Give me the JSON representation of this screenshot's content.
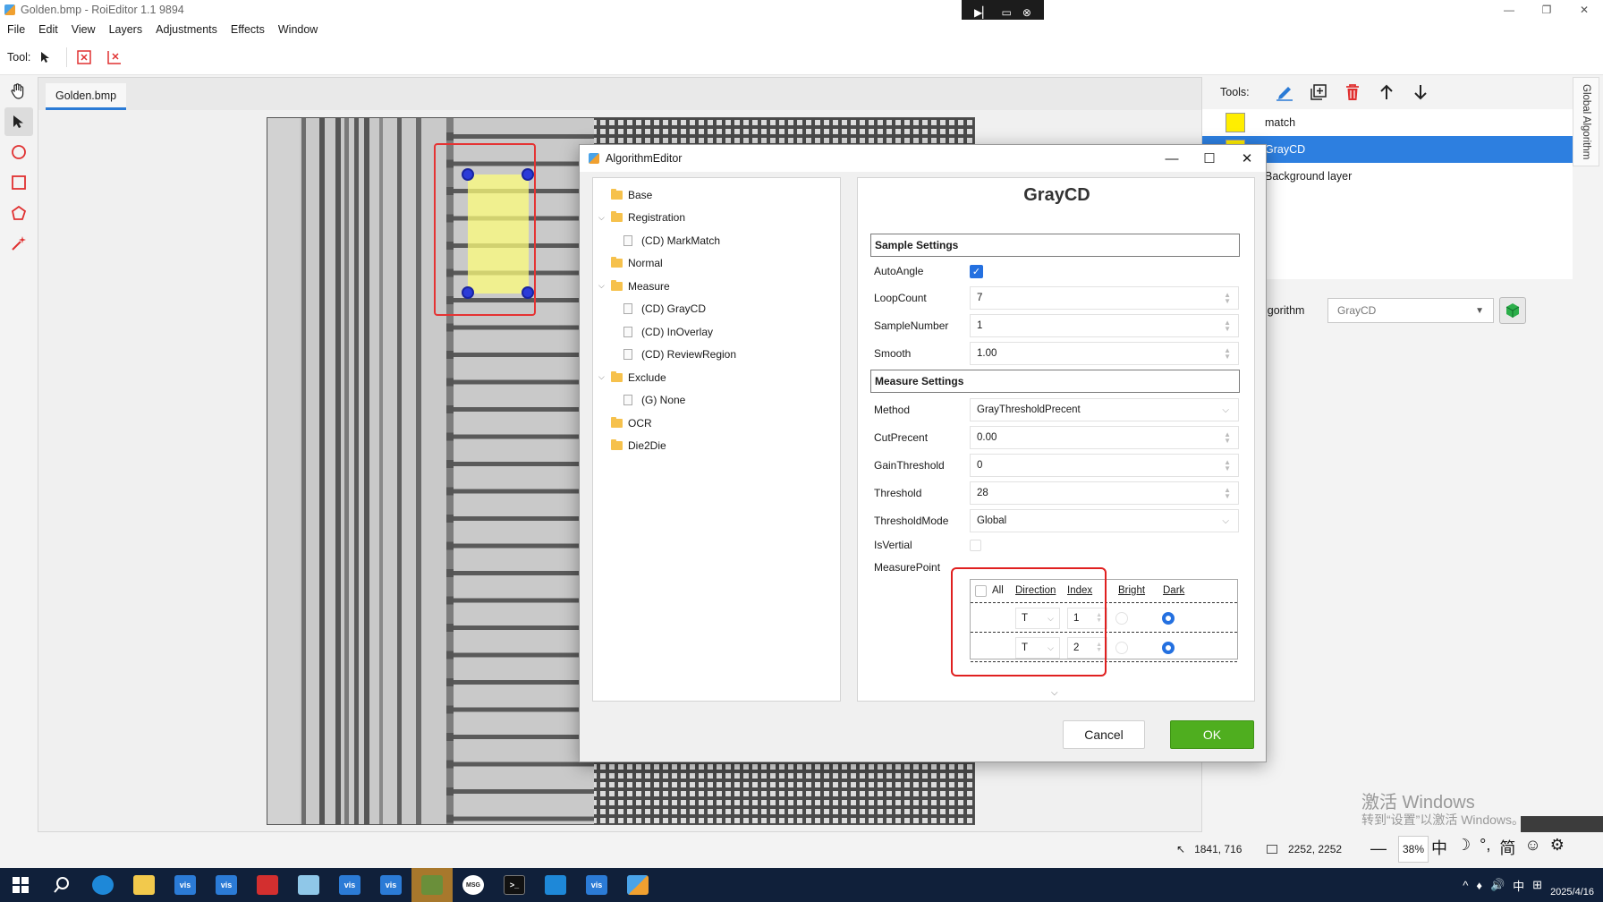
{
  "window": {
    "title": "Golden.bmp - RoiEditor 1.1 9894"
  },
  "menu": [
    "File",
    "Edit",
    "View",
    "Layers",
    "Adjustments",
    "Effects",
    "Window"
  ],
  "toolbar": {
    "label": "Tool:"
  },
  "document": {
    "tab": "Golden.bmp"
  },
  "right_panel": {
    "tools_label": "Tools:",
    "layers": [
      {
        "name": "match",
        "color": "#ffee00",
        "selected": false
      },
      {
        "name": "GrayCD",
        "color": "#ffee00",
        "selected": true
      },
      {
        "name": "Background layer",
        "selected": false
      }
    ],
    "algorithm_label": "lgorithm",
    "algorithm_value": "GrayCD",
    "side_tab": "Global Algorithm"
  },
  "watermark": {
    "line1": "激活 Windows",
    "line2": "转到“设置”以激活 Windows。"
  },
  "status": {
    "cursor": "1841, 716",
    "image_size": "2252, 2252",
    "zoom": "38%"
  },
  "ime": [
    "中",
    "☽",
    "°,",
    "简",
    "☺",
    "⚙"
  ],
  "taskbar": {
    "items": [
      "start",
      "search",
      "edge",
      "explorer",
      "vis",
      "vis",
      "app",
      "notes",
      "vis",
      "vis",
      "remote",
      "msg",
      "terminal",
      "bar",
      "vis",
      "roieditor"
    ],
    "tray": [
      "^",
      "♦",
      "🔊",
      "中",
      "⊞"
    ],
    "date": "2025/4/16"
  },
  "dialog": {
    "title": "AlgorithmEditor",
    "tree": [
      {
        "label": "Base",
        "kind": "folder",
        "level": 0,
        "expanded": null
      },
      {
        "label": "Registration",
        "kind": "folder",
        "level": 0,
        "expanded": true
      },
      {
        "label": "(CD) MarkMatch",
        "kind": "item",
        "level": 1
      },
      {
        "label": "Normal",
        "kind": "folder",
        "level": 0,
        "expanded": null
      },
      {
        "label": "Measure",
        "kind": "folder",
        "level": 0,
        "expanded": true
      },
      {
        "label": "(CD) GrayCD",
        "kind": "item",
        "level": 1
      },
      {
        "label": "(CD) InOverlay",
        "kind": "item",
        "level": 1
      },
      {
        "label": "(CD) ReviewRegion",
        "kind": "item",
        "level": 1
      },
      {
        "label": "Exclude",
        "kind": "folder",
        "level": 0,
        "expanded": true
      },
      {
        "label": "(G) None",
        "kind": "item",
        "level": 1
      },
      {
        "label": "OCR",
        "kind": "folder",
        "level": 0,
        "expanded": null
      },
      {
        "label": "Die2Die",
        "kind": "folder",
        "level": 0,
        "expanded": null
      }
    ],
    "props_title": "GrayCD",
    "sample_settings": "Sample Settings",
    "measure_settings": "Measure Settings",
    "auto_angle": {
      "label": "AutoAngle",
      "checked": true
    },
    "loop_count": {
      "label": "LoopCount",
      "value": "7"
    },
    "sample_number": {
      "label": "SampleNumber",
      "value": "1"
    },
    "smooth": {
      "label": "Smooth",
      "value": "1.00"
    },
    "method": {
      "label": "Method",
      "value": "GrayThresholdPrecent"
    },
    "cut_precent": {
      "label": "CutPrecent",
      "value": "0.00"
    },
    "gain_threshold": {
      "label": "GainThreshold",
      "value": "0"
    },
    "threshold": {
      "label": "Threshold",
      "value": "28"
    },
    "threshold_mode": {
      "label": "ThresholdMode",
      "value": "Global"
    },
    "is_vertial": {
      "label": "IsVertial",
      "checked": false
    },
    "measure_point": {
      "label": "MeasurePoint",
      "headers": {
        "all": "All",
        "direction": "Direction",
        "index": "Index",
        "bright": "Bright",
        "dark": "Dark"
      },
      "rows": [
        {
          "direction": "T",
          "index": "1",
          "dark": true
        },
        {
          "direction": "T",
          "index": "2",
          "dark": true
        }
      ]
    },
    "cancel": "Cancel",
    "ok": "OK"
  }
}
